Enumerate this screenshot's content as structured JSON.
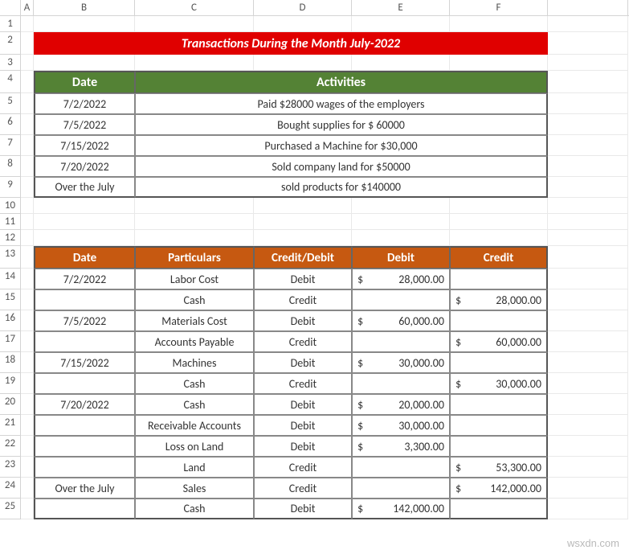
{
  "column_headers": [
    "A",
    "B",
    "C",
    "D",
    "E",
    "F"
  ],
  "row_numbers": [
    "1",
    "2",
    "3",
    "4",
    "5",
    "6",
    "7",
    "8",
    "9",
    "10",
    "11",
    "12",
    "13",
    "14",
    "15",
    "16",
    "17",
    "18",
    "19",
    "20",
    "21",
    "22",
    "23",
    "24",
    "25"
  ],
  "title": "Transactions During the Month July-2022",
  "table1": {
    "headers": {
      "date": "Date",
      "activities": "Activities"
    },
    "rows": [
      {
        "date": "7/2/2022",
        "activity": "Paid $28000 wages of the employers"
      },
      {
        "date": "7/5/2022",
        "activity": "Bought supplies for $ 60000"
      },
      {
        "date": "7/15/2022",
        "activity": "Purchased a Machine for $30,000"
      },
      {
        "date": "7/20/2022",
        "activity": "Sold company land for $50000"
      },
      {
        "date": "Over the July",
        "activity": "sold products for $140000"
      }
    ]
  },
  "table2": {
    "headers": {
      "date": "Date",
      "particulars": "Particulars",
      "cd": "Credit/Debit",
      "debit": "Debit",
      "credit": "Credit"
    },
    "rows": [
      {
        "date": "7/2/2022",
        "part": "Labor Cost",
        "cd": "Debit",
        "debit": "28,000.00",
        "credit": ""
      },
      {
        "date": "",
        "part": "Cash",
        "cd": "Credit",
        "debit": "",
        "credit": "28,000.00"
      },
      {
        "date": "7/5/2022",
        "part": "Materials Cost",
        "cd": "Debit",
        "debit": "60,000.00",
        "credit": ""
      },
      {
        "date": "",
        "part": "Accounts Payable",
        "cd": "Credit",
        "debit": "",
        "credit": "60,000.00"
      },
      {
        "date": "7/15/2022",
        "part": "Machines",
        "cd": "Debit",
        "debit": "30,000.00",
        "credit": ""
      },
      {
        "date": "",
        "part": "Cash",
        "cd": "Credit",
        "debit": "",
        "credit": "30,000.00"
      },
      {
        "date": "7/20/2022",
        "part": "Cash",
        "cd": "Debit",
        "debit": "20,000.00",
        "credit": ""
      },
      {
        "date": "",
        "part": "Receivable Accounts",
        "cd": "Debit",
        "debit": "30,000.00",
        "credit": ""
      },
      {
        "date": "",
        "part": "Loss on Land",
        "cd": "Debit",
        "debit": "3,300.00",
        "credit": ""
      },
      {
        "date": "",
        "part": "Land",
        "cd": "Credit",
        "debit": "",
        "credit": "53,300.00"
      },
      {
        "date": "Over the July",
        "part": "Sales",
        "cd": "Credit",
        "debit": "",
        "credit": "142,000.00"
      },
      {
        "date": "",
        "part": "Cash",
        "cd": "Debit",
        "debit": "142,000.00",
        "credit": ""
      }
    ]
  },
  "currency_symbol": "$",
  "watermark": "wsxdn.com",
  "chart_data": {
    "type": "table",
    "title": "Transactions During the Month July-2022",
    "columns": [
      "Date",
      "Particulars",
      "Credit/Debit",
      "Debit",
      "Credit"
    ],
    "rows": [
      [
        "7/2/2022",
        "Labor Cost",
        "Debit",
        28000,
        null
      ],
      [
        "",
        "Cash",
        "Credit",
        null,
        28000
      ],
      [
        "7/5/2022",
        "Materials Cost",
        "Debit",
        60000,
        null
      ],
      [
        "",
        "Accounts Payable",
        "Credit",
        null,
        60000
      ],
      [
        "7/15/2022",
        "Machines",
        "Debit",
        30000,
        null
      ],
      [
        "",
        "Cash",
        "Credit",
        null,
        30000
      ],
      [
        "7/20/2022",
        "Cash",
        "Debit",
        20000,
        null
      ],
      [
        "",
        "Receivable Accounts",
        "Debit",
        30000,
        null
      ],
      [
        "",
        "Loss on Land",
        "Debit",
        3300,
        null
      ],
      [
        "",
        "Land",
        "Credit",
        null,
        53300
      ],
      [
        "Over the July",
        "Sales",
        "Credit",
        null,
        142000
      ],
      [
        "",
        "Cash",
        "Debit",
        142000,
        null
      ]
    ]
  }
}
